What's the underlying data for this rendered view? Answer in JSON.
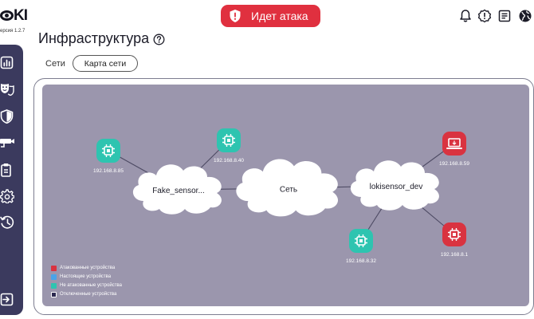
{
  "app": {
    "logo_text": "KI",
    "version": "ерсия 1.2.7"
  },
  "banner": {
    "text": "Идет атака",
    "color": "#e0303f",
    "icon": "shield-alert-icon"
  },
  "header_icons": [
    "bell-icon",
    "alert-circle-icon",
    "document-icon",
    "globe-icon"
  ],
  "page": {
    "title": "Инфраструктура",
    "help_icon": "help-icon"
  },
  "tabs": {
    "label": "Сети",
    "button": "Карта сети"
  },
  "sidebar": {
    "items": [
      {
        "icon": "chart-icon",
        "active": false
      },
      {
        "icon": "masks-icon",
        "active": true
      },
      {
        "icon": "shield-icon",
        "active": false
      },
      {
        "icon": "camera-icon",
        "active": false
      },
      {
        "icon": "clipboard-icon",
        "active": false
      },
      {
        "icon": "gear-icon",
        "active": false
      },
      {
        "icon": "history-icon",
        "active": false
      }
    ],
    "bottom_icon": "logout-icon"
  },
  "network_map": {
    "colors": {
      "attacked": "#d93340",
      "real": "#4aa3e8",
      "not_attacked": "#2ec4b0",
      "offline": "#2c2950",
      "background": "#9b96ad",
      "cloud": "#ffffff",
      "link": "#4d4a63"
    },
    "clouds": [
      {
        "id": "fake",
        "label": "Fake_sensor..."
      },
      {
        "id": "net",
        "label": "Сеть"
      },
      {
        "id": "loki",
        "label": "lokisensor_dev"
      }
    ],
    "devices": [
      {
        "ip": "192.168.8.85",
        "status": "not_attacked",
        "icon": "chip-icon"
      },
      {
        "ip": "192.168.8.40",
        "status": "not_attacked",
        "icon": "chip-icon"
      },
      {
        "ip": "192.168.8.59",
        "status": "attacked",
        "icon": "laptop-icon"
      },
      {
        "ip": "192.168.8.32",
        "status": "not_attacked",
        "icon": "chip-icon"
      },
      {
        "ip": "192.168.8.1",
        "status": "attacked",
        "icon": "chip-icon"
      }
    ],
    "links": [
      [
        "fake",
        "net"
      ],
      [
        "net",
        "loki"
      ],
      [
        "fake",
        "192.168.8.85"
      ],
      [
        "fake",
        "192.168.8.40"
      ],
      [
        "loki",
        "192.168.8.59"
      ],
      [
        "loki",
        "192.168.8.32"
      ],
      [
        "loki",
        "192.168.8.1"
      ]
    ],
    "legend": [
      {
        "label": "Атакованные устройства",
        "color": "#d93340"
      },
      {
        "label": "Настоящие устройства",
        "color": "#4aa3e8"
      },
      {
        "label": "Не атакованные устройства",
        "color": "#2ec4b0"
      },
      {
        "label": "Отключенные устройства",
        "color": "#2c2950"
      }
    ]
  }
}
